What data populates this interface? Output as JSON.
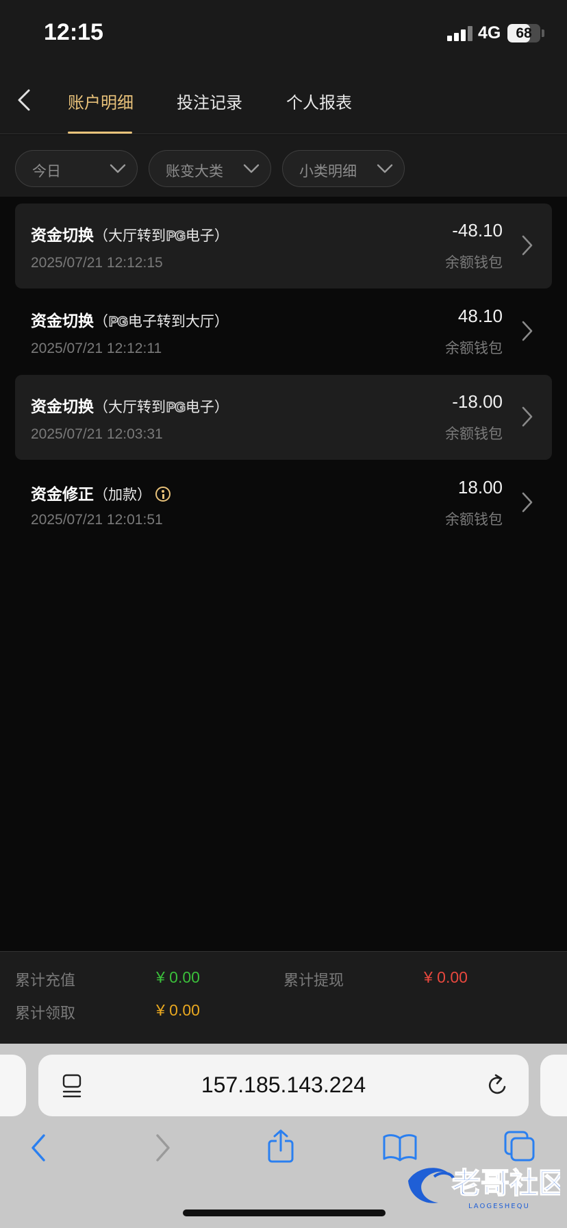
{
  "status": {
    "time": "12:15",
    "network": "4G",
    "battery": "68",
    "battery_level": 0.68
  },
  "nav": {
    "tabs": [
      {
        "label": "账户明细",
        "active": true
      },
      {
        "label": "投注记录",
        "active": false
      },
      {
        "label": "个人报表",
        "active": false
      }
    ]
  },
  "filters": [
    {
      "label": "今日"
    },
    {
      "label": "账变大类"
    },
    {
      "label": "小类明细"
    }
  ],
  "records": [
    {
      "type": "资金切换",
      "detail_pre": "（大厅转到",
      "brand": "PG",
      "detail_post": "电子）",
      "date": "2025/07/21 12:12:15",
      "amount": "-48.10",
      "wallet": "余额钱包"
    },
    {
      "type": "资金切换",
      "detail_pre": "（",
      "brand": "PG",
      "detail_post": "电子转到大厅）",
      "date": "2025/07/21 12:12:11",
      "amount": "48.10",
      "wallet": "余额钱包"
    },
    {
      "type": "资金切换",
      "detail_pre": "（大厅转到",
      "brand": "PG",
      "detail_post": "电子）",
      "date": "2025/07/21 12:03:31",
      "amount": "-18.00",
      "wallet": "余额钱包"
    },
    {
      "type": "资金修正",
      "detail_pre": "（加款）",
      "brand": "",
      "detail_post": "",
      "date": "2025/07/21 12:01:51",
      "amount": "18.00",
      "wallet": "余额钱包"
    }
  ],
  "summary": {
    "recharge_label": "累计充值",
    "recharge_value": "¥ 0.00",
    "withdraw_label": "累计提现",
    "withdraw_value": "¥ 0.00",
    "claim_label": "累计领取",
    "claim_value": "¥ 0.00"
  },
  "browser": {
    "url": "157.185.143.224"
  },
  "watermark": {
    "text": "老哥社区",
    "subtext": "LAOGESHEQU"
  },
  "colors": {
    "accent": "#e9c27a",
    "positive": "#3bbf3b",
    "negative": "#e8483e",
    "claim": "#e9a820"
  }
}
